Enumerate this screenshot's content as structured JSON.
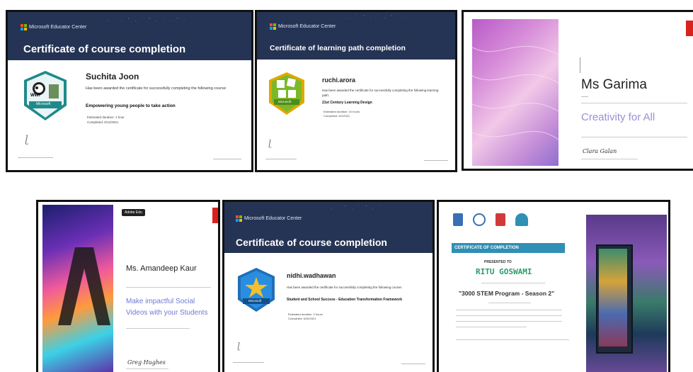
{
  "cert1": {
    "brand": "Microsoft  Educator Center",
    "title": "Certificate of course completion",
    "name": "Suchita Joon",
    "body": "Has been awarded the certificate for successfully completing the following course:",
    "course": "Empowering young people to take action",
    "badge_logo": "WWF",
    "badge_label": "Microsoft",
    "duration": "Estimated duration: 1 hour",
    "completed": "Completed: 6/12/2021"
  },
  "cert2": {
    "brand": "Microsoft  Educator Center",
    "title": "Certificate of learning path completion",
    "name": "ruchi.arora",
    "body": "Has been awarded the certificate for successfully completing the following learning path:",
    "course": "21st Century Learning Design",
    "badge_label": "Microsoft",
    "duration": "Estimated duration: 10 hours",
    "completed": "Completed: 6/1/2021"
  },
  "cert3": {
    "name": "Ms Garima",
    "course": "Creativity for All",
    "signature": "Clara Galan",
    "colors": {
      "accent": "#9a8fd6",
      "logo": "#d9221c"
    }
  },
  "cert4": {
    "tag": "Adobe Edu",
    "name": "Ms. Amandeep Kaur",
    "course": "Make impactful Social Videos with your Students",
    "signature": "Greg Hughes",
    "colors": {
      "accent": "#6f79d4",
      "logo": "#d9221c"
    }
  },
  "cert5": {
    "brand": "Microsoft  Educator Center",
    "title": "Certificate of course completion",
    "name": "nidhi.wadhawan",
    "body": "Has been awarded the certificate for successfully completing the following course:",
    "course": "Student and School Success - Education Transformation Framework",
    "badge_label": "Microsoft",
    "duration": "Estimated duration: 2 hours",
    "completed": "Completed: 6/25/2021"
  },
  "cert6": {
    "banner": "CERTIFICATE OF COMPLETION",
    "presented": "PRESENTED TO",
    "name": "RITU GOSWAMI",
    "program": "\"3000 STEM Program - Season 2\"",
    "colors": {
      "banner": "#2f8fb4",
      "name": "#2c9c6b"
    }
  }
}
